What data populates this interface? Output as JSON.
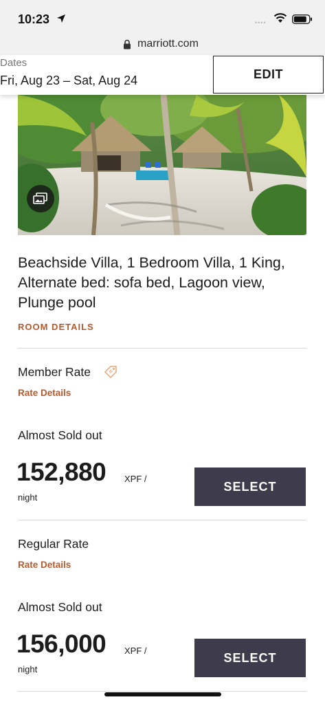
{
  "status_bar": {
    "time": "10:23",
    "signal_dots": "••••"
  },
  "browser": {
    "url": "marriott.com"
  },
  "dates": {
    "label": "Dates",
    "value": "Fri, Aug 23 – Sat, Aug 24",
    "edit_label": "EDIT"
  },
  "room": {
    "title": "Beachside Villa, 1 Bedroom Villa, 1 King, Alternate bed: sofa bed, Lagoon view, Plunge pool",
    "details_link": "ROOM DETAILS"
  },
  "rates": [
    {
      "name": "Member Rate",
      "details_link": "Rate Details",
      "availability": "Almost Sold out",
      "price": "152,880",
      "currency": "XPF /",
      "per": "night",
      "select_label": "SELECT"
    },
    {
      "name": "Regular Rate",
      "details_link": "Rate Details",
      "availability": "Almost Sold out",
      "price": "156,000",
      "currency": "XPF /",
      "per": "night",
      "select_label": "SELECT"
    }
  ],
  "colors": {
    "accent": "#b8592c",
    "button": "#3e3b4d"
  },
  "icons": [
    "location-arrow-icon",
    "wifi-icon",
    "battery-icon",
    "lock-icon",
    "gallery-icon",
    "tag-icon"
  ]
}
